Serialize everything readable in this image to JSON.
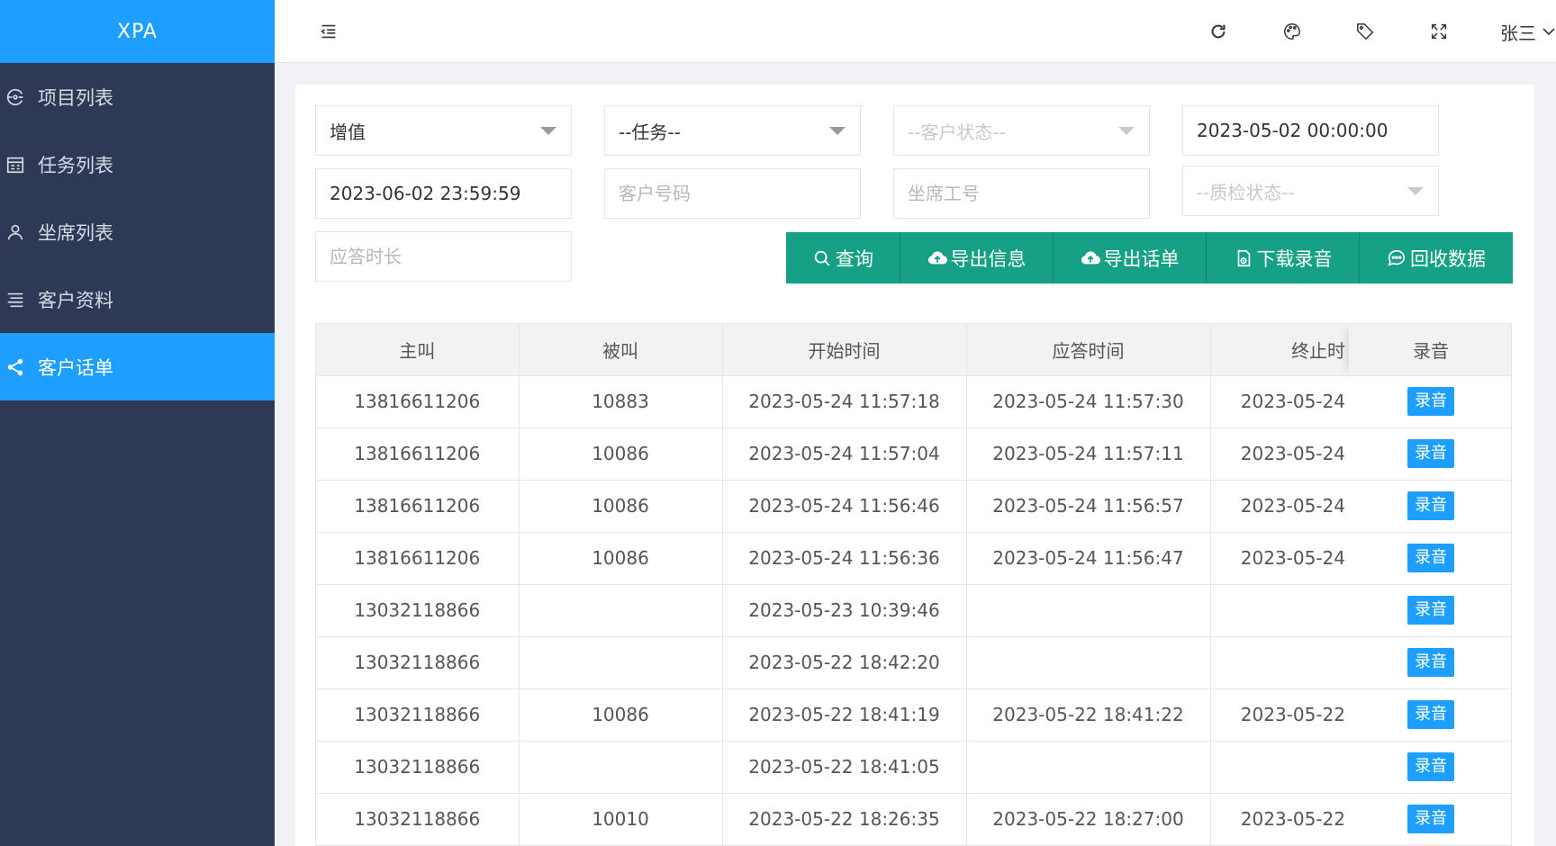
{
  "app": {
    "logo": "XPA"
  },
  "sidebar": {
    "items": [
      {
        "label": "项目列表",
        "icon": "project-icon",
        "active": false
      },
      {
        "label": "任务列表",
        "icon": "task-icon",
        "active": false
      },
      {
        "label": "坐席列表",
        "icon": "user-icon",
        "active": false
      },
      {
        "label": "客户资料",
        "icon": "list-icon",
        "active": false
      },
      {
        "label": "客户话单",
        "icon": "share-icon",
        "active": true
      }
    ]
  },
  "header": {
    "user_name": "张三",
    "icons": [
      "menu-fold-icon",
      "refresh-icon",
      "palette-icon",
      "tag-icon",
      "fullscreen-icon",
      "chevron-down-icon"
    ]
  },
  "filters": {
    "business_type": "增值",
    "task": "--任务--",
    "customer_status": "--客户状态--",
    "start_time": "2023-05-02 00:00:00",
    "end_time": "2023-06-02 23:59:59",
    "customer_number_placeholder": "客户号码",
    "agent_id_placeholder": "坐席工号",
    "qc_status": "--质检状态--",
    "answer_duration_placeholder": "应答时长"
  },
  "actions": {
    "query": "查询",
    "export_info": "导出信息",
    "export_calls": "导出话单",
    "download_recording": "下载录音",
    "recycle_data": "回收数据"
  },
  "table": {
    "headers": {
      "caller": "主叫",
      "callee": "被叫",
      "start_time": "开始时间",
      "answer_time": "应答时间",
      "end_time": "终止时",
      "recording": "录音"
    },
    "record_button_label": "录音",
    "rows": [
      {
        "caller": "13816611206",
        "callee": "10883",
        "start": "2023-05-24 11:57:18",
        "answer": "2023-05-24 11:57:30",
        "end": "2023-05-24"
      },
      {
        "caller": "13816611206",
        "callee": "10086",
        "start": "2023-05-24 11:57:04",
        "answer": "2023-05-24 11:57:11",
        "end": "2023-05-24"
      },
      {
        "caller": "13816611206",
        "callee": "10086",
        "start": "2023-05-24 11:56:46",
        "answer": "2023-05-24 11:56:57",
        "end": "2023-05-24"
      },
      {
        "caller": "13816611206",
        "callee": "10086",
        "start": "2023-05-24 11:56:36",
        "answer": "2023-05-24 11:56:47",
        "end": "2023-05-24"
      },
      {
        "caller": "13032118866",
        "callee": "",
        "start": "2023-05-23 10:39:46",
        "answer": "",
        "end": ""
      },
      {
        "caller": "13032118866",
        "callee": "",
        "start": "2023-05-22 18:42:20",
        "answer": "",
        "end": ""
      },
      {
        "caller": "13032118866",
        "callee": "10086",
        "start": "2023-05-22 18:41:19",
        "answer": "2023-05-22 18:41:22",
        "end": "2023-05-22"
      },
      {
        "caller": "13032118866",
        "callee": "",
        "start": "2023-05-22 18:41:05",
        "answer": "",
        "end": ""
      },
      {
        "caller": "13032118866",
        "callee": "10010",
        "start": "2023-05-22 18:26:35",
        "answer": "2023-05-22 18:27:00",
        "end": "2023-05-22"
      }
    ]
  },
  "colors": {
    "sidebar_bg": "#2e3a55",
    "accent_blue": "#1e9fff",
    "action_green": "#16a085"
  }
}
